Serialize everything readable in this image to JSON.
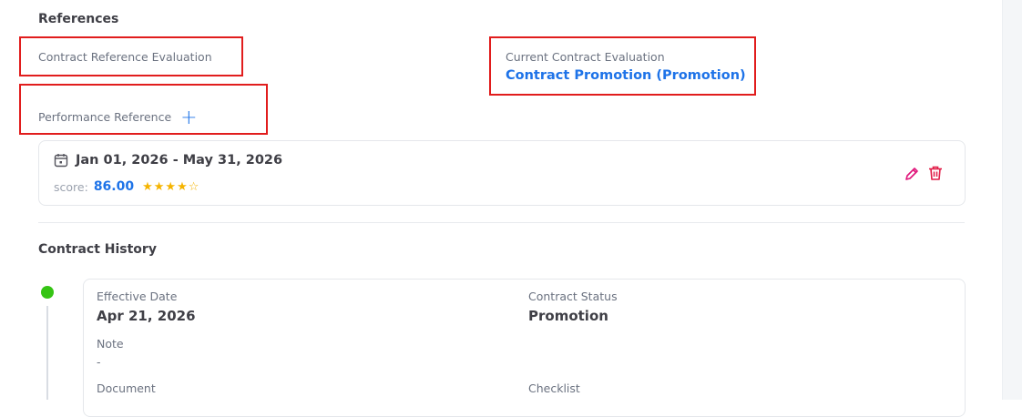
{
  "references": {
    "title": "References",
    "contract_reference_evaluation_label": "Contract Reference Evaluation",
    "current_contract_evaluation_label": "Current Contract Evaluation",
    "current_contract_evaluation_value": "Contract Promotion (Promotion)",
    "performance_reference_label": "Performance Reference",
    "add_icon": "plus-icon"
  },
  "performance_item": {
    "date_range": "Jan 01, 2026 - May 31, 2026",
    "score_label": "score:",
    "score_value": "86.00",
    "stars_display": "★★★★☆",
    "rating": 4,
    "rating_max": 5,
    "calendar_icon": "calendar-icon",
    "edit_icon": "pencil-icon",
    "delete_icon": "trash-icon"
  },
  "contract_history": {
    "title": "Contract History",
    "entries": [
      {
        "effective_date_label": "Effective Date",
        "effective_date_value": "Apr 21, 2026",
        "contract_status_label": "Contract Status",
        "contract_status_value": "Promotion",
        "note_label": "Note",
        "note_value": "-",
        "document_label": "Document",
        "checklist_label": "Checklist"
      }
    ]
  },
  "colors": {
    "accent_blue": "#1e73e8",
    "highlight_red": "#e11d1d",
    "star_gold": "#f5b400",
    "action_pink": "#e0157a",
    "status_green": "#35c414"
  }
}
